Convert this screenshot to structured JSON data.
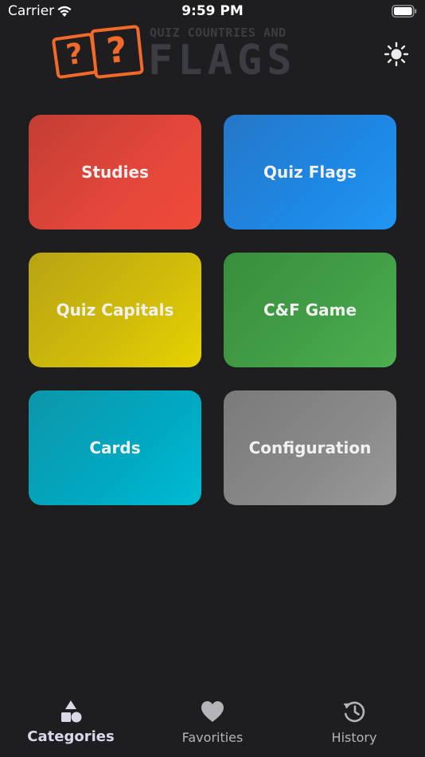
{
  "status_bar": {
    "carrier": "Carrier",
    "time": "9:59 PM",
    "icons": [
      "wifi-icon",
      "battery-icon"
    ]
  },
  "header": {
    "logo_text_small": "QUIZ COUNTRIES AND",
    "logo_text_big": "FLAGS",
    "dice_glyph": "?",
    "theme_icon": "sun-icon"
  },
  "categories": [
    {
      "label": "Studies",
      "color": "#e4473a"
    },
    {
      "label": "Quiz Flags",
      "color": "#1e88e5"
    },
    {
      "label": "Quiz Capitals",
      "color": "#d2bd0a"
    },
    {
      "label": "C&F Game",
      "color": "#43a047"
    },
    {
      "label": "Cards",
      "color": "#00a9c2"
    },
    {
      "label": "Configuration",
      "color": "#8a8a8a"
    }
  ],
  "tab_bar": {
    "tabs": [
      {
        "label": "Categories",
        "icon": "shapes-icon",
        "active": true
      },
      {
        "label": "Favorities",
        "icon": "heart-icon",
        "active": false
      },
      {
        "label": "History",
        "icon": "history-icon",
        "active": false
      }
    ]
  },
  "colors": {
    "background": "#1e1e20",
    "logo_accent": "#f26a2a",
    "logo_text": "#3c3d42",
    "tab_active": "#dcd8ea",
    "tab_inactive": "#b5b5b9"
  }
}
